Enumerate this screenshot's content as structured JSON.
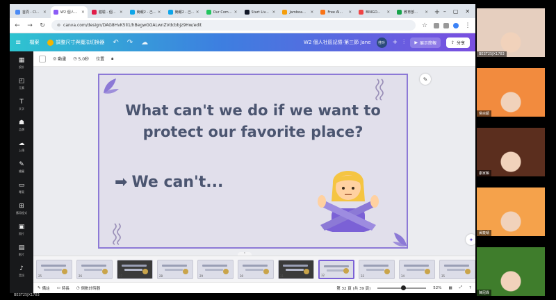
{
  "browser": {
    "tabs": [
      {
        "label": "首頁 - Cl...",
        "color": "#4a8af4",
        "active": false
      },
      {
        "label": "W2 個人...",
        "color": "#8b5cf6",
        "active": true
      },
      {
        "label": "體驗 - 個...",
        "color": "#e11d48",
        "active": false
      },
      {
        "label": "簡報2 - 己...",
        "color": "#0ea5e9",
        "active": false
      },
      {
        "label": "簡報2 - 己...",
        "color": "#0ea5e9",
        "active": false
      },
      {
        "label": "Our Com...",
        "color": "#22c55e",
        "active": false
      },
      {
        "label": "Start Liv...",
        "color": "#111827",
        "active": false
      },
      {
        "label": "Jamboa...",
        "color": "#f59e0b",
        "active": false
      },
      {
        "label": "Free AI...",
        "color": "#f97316",
        "active": false
      },
      {
        "label": "BINGO...",
        "color": "#ef4444",
        "active": false
      },
      {
        "label": "教育部...",
        "color": "#16a34a",
        "active": false
      }
    ],
    "url": "canva.com/design/DAG8HvK5lI1/hBegwGGALwnZVdcbbjz9Hw/edit"
  },
  "canva_header": {
    "file_label": "檔案",
    "resize_label": "調整尺寸與魔法切換器",
    "title": "W2 個人社區記憶-第三節 Jane",
    "avatar": "佳玲",
    "present_label": "展示簡報",
    "share_label": "分享"
  },
  "rail": [
    {
      "icon": "▦",
      "label": "設計",
      "name": "design"
    },
    {
      "icon": "◰",
      "label": "元素",
      "name": "elements"
    },
    {
      "icon": "T",
      "label": "文字",
      "name": "text"
    },
    {
      "icon": "☗",
      "label": "品牌",
      "name": "brand"
    },
    {
      "icon": "☁",
      "label": "上傳",
      "name": "uploads"
    },
    {
      "icon": "✎",
      "label": "繪圖",
      "name": "draw"
    },
    {
      "icon": "▭",
      "label": "專案",
      "name": "projects"
    },
    {
      "icon": "⊞",
      "label": "應用程式",
      "name": "apps"
    },
    {
      "icon": "▣",
      "label": "照片",
      "name": "photos"
    },
    {
      "icon": "▤",
      "label": "影片",
      "name": "videos"
    },
    {
      "icon": "♪",
      "label": "音訊",
      "name": "audio"
    }
  ],
  "toolbar": {
    "animate": "動畫",
    "duration": "5.0秒",
    "position": "位置"
  },
  "slide": {
    "question_line1": "What can't we do if we want to",
    "question_line2": "protect our favorite place?",
    "answer": "We can't...",
    "arrow": "➡"
  },
  "thumbnails": [
    "25",
    "26",
    "27",
    "28",
    "29",
    "30",
    "31",
    "32",
    "33",
    "34",
    "35",
    "36"
  ],
  "selected_thumb": "32",
  "footer": {
    "notes": "備註",
    "duration": "時長",
    "timer": "倒數計時器",
    "page": "第 32 頁 (共 39 頁)",
    "zoom": "52%"
  },
  "taskbar_label": "BEST25JX1783",
  "participants": [
    {
      "name": "BEST25JX1783",
      "bg": "#e6cfbf"
    },
    {
      "name": "吳宗穎",
      "bg": "#f28b3e"
    },
    {
      "name": "康家輯",
      "bg": "#5b2e1e"
    },
    {
      "name": "黃筱晴",
      "bg": "#f5a24b"
    },
    {
      "name": "陳冠霖",
      "bg": "#3f7d2c"
    }
  ]
}
